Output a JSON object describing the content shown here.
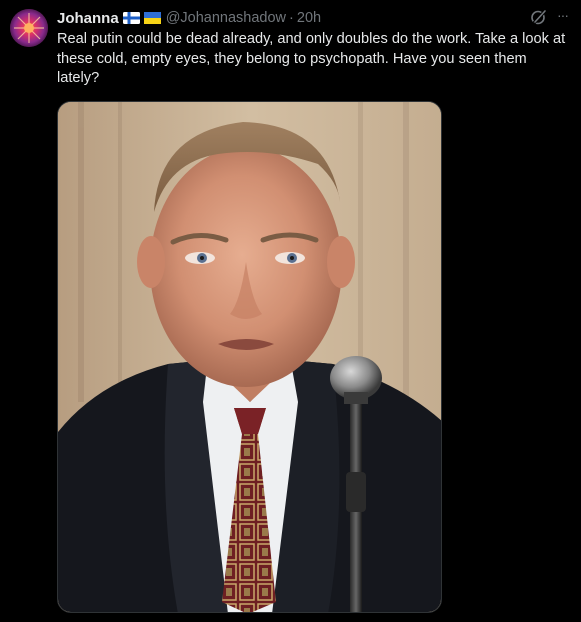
{
  "tweet": {
    "author_name": "Johanna",
    "handle": "@Johannashadow",
    "separator": "·",
    "time": "20h",
    "text": "Real putin could be dead already, and only doubles do the work. Take a look at these cold, empty eyes, they belong to psychopath. Have you seen them lately?",
    "flags": [
      "finland-flag-icon",
      "ukraine-flag-icon"
    ],
    "more_label": "···"
  },
  "media": {
    "description_icon": "photo-of-man-in-suit-at-microphone"
  },
  "colors": {
    "background": "#000000",
    "text": "#e7e9ea",
    "secondary_text": "#71767b",
    "border": "#2f3336"
  }
}
